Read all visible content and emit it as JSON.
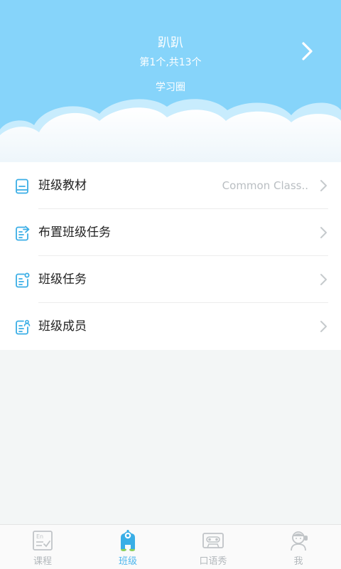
{
  "header": {
    "class_name": "趴趴",
    "class_index": "第1个,共13个",
    "circle_label": "学习圈"
  },
  "menu": {
    "items": [
      {
        "label": "班级教材",
        "value": "Common Class.."
      },
      {
        "label": "布置班级任务",
        "value": ""
      },
      {
        "label": "班级任务",
        "value": ""
      },
      {
        "label": "班级成员",
        "value": ""
      }
    ]
  },
  "tabbar": {
    "tabs": [
      {
        "label": "课程",
        "icon": "course-book-icon",
        "active": false
      },
      {
        "label": "班级",
        "icon": "class-mascot-icon",
        "active": true
      },
      {
        "label": "口语秀",
        "icon": "cassette-icon",
        "active": false
      },
      {
        "label": "我",
        "icon": "profile-avatar-icon",
        "active": false
      }
    ]
  },
  "colors": {
    "header_bg": "#86d4fa",
    "accent": "#4fb7ee",
    "icon_blue": "#3aaee6",
    "inactive": "#b3b8bc"
  }
}
